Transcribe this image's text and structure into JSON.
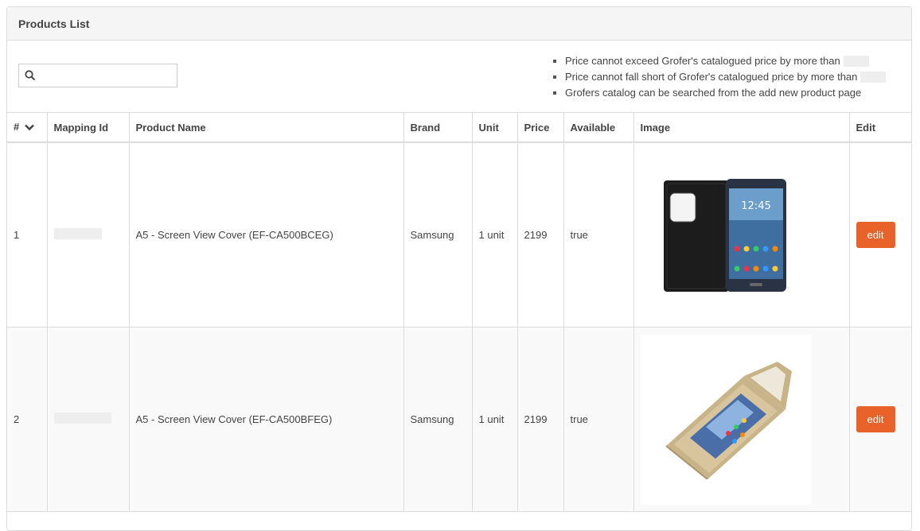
{
  "panel": {
    "title": "Products List"
  },
  "search": {
    "placeholder": "",
    "value": ""
  },
  "notes": [
    "Price cannot exceed Grofer's catalogued price by more than",
    "Price cannot fall short of Grofer's catalogued price by more than",
    "Grofers catalog can be searched from the add new product page"
  ],
  "table": {
    "columns": [
      "#",
      "Mapping Id",
      "Product Name",
      "Brand",
      "Unit",
      "Price",
      "Available",
      "Image",
      "Edit"
    ],
    "rows": [
      {
        "index": "1",
        "mapping_id": "",
        "product_name": "A5 - Screen View Cover (EF-CA500BCEG)",
        "brand": "Samsung",
        "unit": "1 unit",
        "price": "2199",
        "available": "true",
        "image": "black flip cover phone case",
        "edit_label": "edit"
      },
      {
        "index": "2",
        "mapping_id": "",
        "product_name": "A5 - Screen View Cover (EF-CA500BFEG)",
        "brand": "Samsung",
        "unit": "1 unit",
        "price": "2199",
        "available": "true",
        "image": "gold flip cover phone case",
        "edit_label": "edit"
      }
    ]
  },
  "phone_screen": {
    "time": "12:45"
  },
  "icons": {
    "search": "search-icon",
    "sort": "chevron-down-icon"
  },
  "colors": {
    "accent": "#e8622a",
    "header_bg": "#f5f5f5",
    "border": "#dcdcdc"
  }
}
